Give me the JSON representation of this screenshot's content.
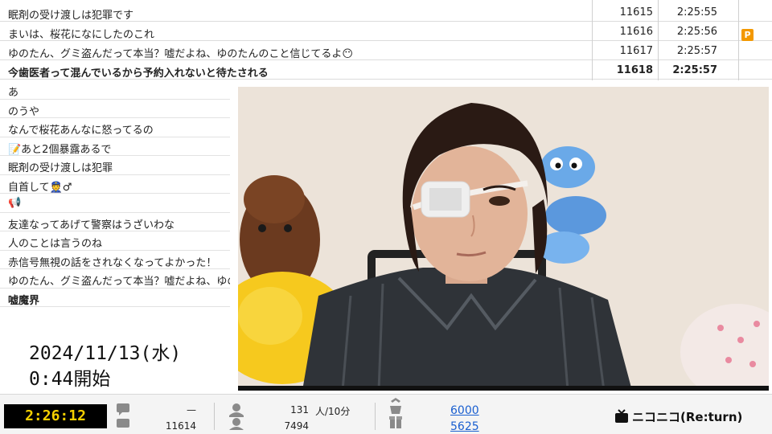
{
  "top_comments": [
    {
      "text": "眠剤の受け渡しは犯罪です",
      "no": "11615",
      "time": "2:25:55",
      "badge": ""
    },
    {
      "text": "まいは、桜花になにしたのこれ",
      "no": "11616",
      "time": "2:25:56",
      "badge": "P"
    },
    {
      "text": "ゆのたん、グミ盗んだって本当？嘘だよね、ゆのたんのこと信じてるよ😶",
      "no": "11617",
      "time": "2:25:57",
      "badge": ""
    },
    {
      "text": "今歯医者って混んでいるから予約入れないと待たされる",
      "no": "11618",
      "time": "2:25:57",
      "badge": "",
      "bold": true
    }
  ],
  "left_comments": [
    {
      "text": "あ"
    },
    {
      "text": "のうや"
    },
    {
      "text": "なんで桜花あんなに怒ってるの"
    },
    {
      "text": "📝あと2個暴露あるで"
    },
    {
      "text": "眠剤の受け渡しは犯罪"
    },
    {
      "text": "自首して👮♂"
    },
    {
      "text": "📢"
    },
    {
      "text": "友達なってあげて警察はうざいわな"
    },
    {
      "text": "人のことは言うのね"
    },
    {
      "text": "赤信号無視の話をされなくなってよかった！"
    },
    {
      "text": "ゆのたん、グミ盗んだって本当？嘘だよね、ゆのた"
    },
    {
      "text": "嘘魔界",
      "bold": true
    }
  ],
  "date": {
    "line1": "2024/11/13(水)",
    "line2": "0:44開始"
  },
  "bottom": {
    "clock": "2:26:12",
    "comments_top": "—",
    "comments_total": "11614",
    "viewers_top": "131",
    "viewers_unit": "人/10分",
    "viewers_total": "7494",
    "ad_points": "6000",
    "gift_points": "5625",
    "logo": "ニコニコ(Re:turn)"
  },
  "colors": {
    "clock_bg": "#000000",
    "clock_fg": "#f5d000",
    "badge": "#f39800",
    "link": "#1a5fd0"
  }
}
